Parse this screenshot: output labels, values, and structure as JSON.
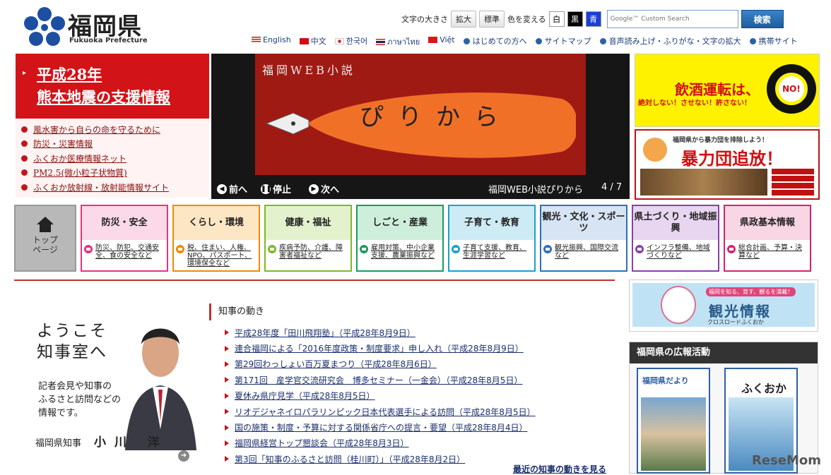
{
  "header": {
    "logo_jp": "福岡県",
    "logo_en": "Fukuoka Prefecture",
    "font_size_label": "文字の大きさ",
    "enlarge": "拡大",
    "standard": "標準",
    "color_label": "色を変える",
    "color_white": "白",
    "color_black": "黒",
    "color_blue": "青",
    "search_placeholder": "Google™ Custom Search",
    "search_button": "検索"
  },
  "lang_links": [
    "English",
    "中文",
    "한국어",
    "ภาษาไทย",
    "Việt"
  ],
  "util_links": [
    "はじめての方へ",
    "サイトマップ",
    "音声読み上げ・ふりがな・文字の拡大",
    "携帯サイト"
  ],
  "quake": {
    "line1": "平成28年",
    "line2": "熊本地震の支援情報"
  },
  "emergency_links": [
    "風水害から自らの命を守るために",
    "防災・災害情報",
    "ふくおか医療情報ネット",
    "PM2.5(微小粒子状物質)",
    "ふくおか放射線・放射能情報サイト"
  ],
  "slideshow": {
    "title": "福岡WEB小説",
    "main_text": "ぴりから",
    "prev": "前へ",
    "stop": "停止",
    "next": "次へ",
    "caption": "福岡WEB小説ぴりから",
    "counter": "4 / 7"
  },
  "banners": {
    "drunk_main": "飲酒運転は、",
    "drunk_sub": "絶対しない！させない！許さない！",
    "drunk_no": "NO!",
    "yakuza_top": "福岡県から暴力団を排除しよう！",
    "yakuza_main": "暴力団追放！"
  },
  "nav": {
    "top_label": "トップページ",
    "categories": [
      {
        "title": "防災・安全",
        "desc": "防災、防犯、交通安全、食の安全など",
        "color": "#e8337e",
        "bg": "#fbd9e8"
      },
      {
        "title": "くらし・環境",
        "desc": "税、住まい、人権、NPO、パスポート、環境保全など",
        "color": "#f08a00",
        "bg": "#fde6c4"
      },
      {
        "title": "健康・福祉",
        "desc": "疾病予防、介護、障害者福祉など",
        "color": "#7cb828",
        "bg": "#e3f2cd"
      },
      {
        "title": "しごと・産業",
        "desc": "雇用対策、中小企業支援、農業振興など",
        "color": "#1d9a5a",
        "bg": "#cdeedb"
      },
      {
        "title": "子育て・教育",
        "desc": "子育て支援、教育、生涯学習など",
        "color": "#1ca0c8",
        "bg": "#cdebf5"
      },
      {
        "title": "観光・文化・スポーツ",
        "desc": "観光振興、国際交流など",
        "color": "#2e6fb6",
        "bg": "#d6e4f4"
      },
      {
        "title": "県土づくり・地域振興",
        "desc": "インフラ整備、地域づくりなど",
        "color": "#8b3fa8",
        "bg": "#e8d6f0"
      },
      {
        "title": "県政基本情報",
        "desc": "総合計画、予算・決算など",
        "color": "#d6246e",
        "bg": "#f9d6e4"
      }
    ]
  },
  "governor": {
    "welcome1": "ようこそ",
    "welcome2": "知事室へ",
    "desc1": "記者会見や知事の",
    "desc2": "ふるさと訪問などの",
    "desc3": "情報です。",
    "title": "福岡県知事",
    "name": "小川 洋"
  },
  "news": {
    "heading": "知事の動き",
    "items": [
      "平成28年度「田川飛翔塾」（平成28年8月9日）",
      "連合福岡による「2016年度政策・制度要求」申し入れ（平成28年8月9日）",
      "第29回わっしょい百万夏まつり（平成28年8月6日）",
      "第171回　産学官交流研究会　博多セミナー（一金会）（平成28年8月5日）",
      "夏休み県庁見学（平成28年8月5日）",
      "リオデジャネイロパラリンピック日本代表選手による訪問（平成28年8月5日）",
      "国の施策・制度・予算に対する関係省庁への提言・要望（平成28年8月4日）",
      "福岡県経営トップ懇談会（平成28年8月3日）",
      "第3回「知事のふるさと訪問（桂川町）」（平成28年8月2日）"
    ],
    "more": "最近の知事の動きを見る"
  },
  "tourism": {
    "main": "観光情報",
    "sub": "クロスロードふくおか",
    "badge": "福岡を知る、育す、観るを満載！"
  },
  "pr": {
    "heading": "福岡県の広報活動",
    "mag1": "福岡県だより",
    "mag2": "ふくおか"
  },
  "watermark": "ReseMom"
}
